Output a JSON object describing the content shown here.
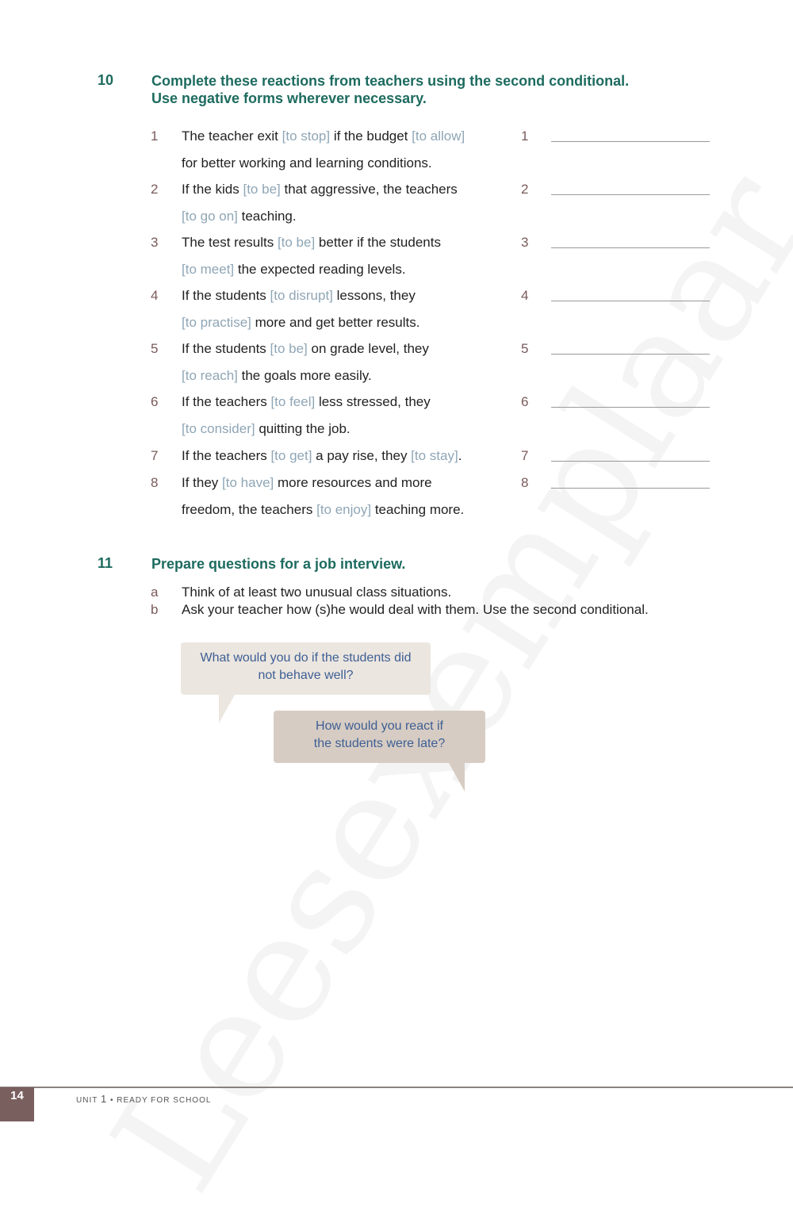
{
  "watermark": "Leesexemplaar",
  "exercise10": {
    "number": "10",
    "title_line1": "Complete these reactions from teachers using the second conditional.",
    "title_line2": "Use negative forms wherever necessary.",
    "items": [
      {
        "num": "1",
        "lines": [
          [
            {
              "t": "The teacher exit "
            },
            {
              "h": "[to stop]"
            },
            {
              "t": " if the budget "
            },
            {
              "h": "[to allow]"
            }
          ],
          [
            {
              "t": "for better working and learning conditions."
            }
          ]
        ]
      },
      {
        "num": "2",
        "lines": [
          [
            {
              "t": "If the kids "
            },
            {
              "h": "[to be]"
            },
            {
              "t": " that aggressive, the teachers"
            }
          ],
          [
            {
              "h": "[to go on]"
            },
            {
              "t": " teaching."
            }
          ]
        ]
      },
      {
        "num": "3",
        "lines": [
          [
            {
              "t": "The test results "
            },
            {
              "h": "[to be]"
            },
            {
              "t": " better if the students"
            }
          ],
          [
            {
              "h": "[to meet]"
            },
            {
              "t": " the expected reading levels."
            }
          ]
        ]
      },
      {
        "num": "4",
        "lines": [
          [
            {
              "t": "If the students "
            },
            {
              "h": "[to disrupt]"
            },
            {
              "t": " lessons, they"
            }
          ],
          [
            {
              "h": "[to practise]"
            },
            {
              "t": " more and get better results."
            }
          ]
        ]
      },
      {
        "num": "5",
        "lines": [
          [
            {
              "t": "If the students "
            },
            {
              "h": "[to be]"
            },
            {
              "t": " on grade level, they"
            }
          ],
          [
            {
              "h": "[to reach]"
            },
            {
              "t": " the goals more easily."
            }
          ]
        ]
      },
      {
        "num": "6",
        "lines": [
          [
            {
              "t": "If the teachers "
            },
            {
              "h": "[to feel]"
            },
            {
              "t": " less stressed, they"
            }
          ],
          [
            {
              "h": "[to consider]"
            },
            {
              "t": " quitting the job."
            }
          ]
        ]
      },
      {
        "num": "7",
        "lines": [
          [
            {
              "t": "If the teachers "
            },
            {
              "h": "[to get]"
            },
            {
              "t": " a pay rise, they "
            },
            {
              "h": "[to stay]"
            },
            {
              "t": "."
            }
          ]
        ]
      },
      {
        "num": "8",
        "lines": [
          [
            {
              "t": "If they "
            },
            {
              "h": "[to have]"
            },
            {
              "t": " more resources and more"
            }
          ],
          [
            {
              "t": "freedom, the teachers "
            },
            {
              "h": "[to enjoy]"
            },
            {
              "t": " teaching more."
            }
          ]
        ]
      }
    ],
    "answer_numbers": [
      "1",
      "2",
      "3",
      "4",
      "5",
      "6",
      "7",
      "8"
    ]
  },
  "exercise11": {
    "number": "11",
    "title": "Prepare questions for a job interview.",
    "items": [
      {
        "label": "a",
        "text": "Think of at least two unusual class situations."
      },
      {
        "label": "b",
        "text": "Ask your teacher how (s)he would deal with them. Use the second conditional."
      }
    ],
    "bubbles": [
      {
        "line1": "What would you do if the students did",
        "line2": "not behave well?"
      },
      {
        "line1": "How would you react if",
        "line2": "the students were late?"
      }
    ]
  },
  "footer": {
    "page": "14",
    "unit_label": "UNIT",
    "unit_num": "1",
    "bullet": "•",
    "section": "READY FOR SCHOOL"
  },
  "colors": {
    "heading": "#1d6b5f",
    "hint": "#8fa6b6",
    "number": "#7a5a5a",
    "bubble1": "#ece6e0",
    "bubble2": "#d7ccc3",
    "bubble_text": "#3d5f94",
    "footer_box": "#7a5f5f"
  }
}
